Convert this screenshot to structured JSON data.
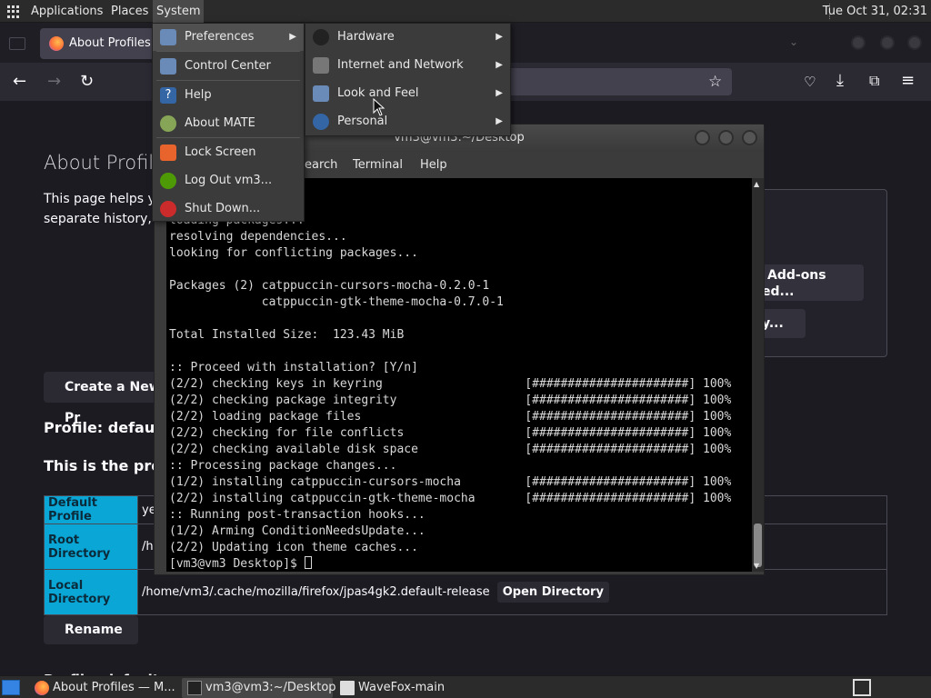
{
  "top_panel": {
    "menus": [
      "Applications",
      "Places",
      "System"
    ],
    "clock": "Tue Oct 31, 02:31"
  },
  "firefox": {
    "tab_title": "About Profiles",
    "content": {
      "title": "About Profile",
      "desc_line1": "This page helps yo",
      "desc_line2": "separate history, bo",
      "addons_btn_line1": "Add-ons",
      "addons_btn_line2": "ed...",
      "ellipsis_btn": "y...",
      "create_btn": "Create a New Pr",
      "profile_heading": "Profile: default-re",
      "profile_sub": "This is the profile",
      "table": {
        "default_profile_key": "Default Profile",
        "default_profile_val": "yes",
        "root_dir_key": "Root Directory",
        "root_dir_val": "/hom",
        "local_dir_key": "Local Directory",
        "local_dir_val": "/home/vm3/.cache/mozilla/firefox/jpas4gk2.default-release",
        "open_dir_btn": "Open Directory"
      },
      "rename_btn": "Rename",
      "cutoff_heading": "Profile: default"
    }
  },
  "terminal": {
    "title": "vm3@vm3:~/Desktop",
    "menus": [
      "earch",
      "Terminal",
      "Help"
    ],
    "lines": [
      "loading packages...",
      "resolving dependencies...",
      "looking for conflicting packages...",
      "",
      "Packages (2) catppuccin-cursors-mocha-0.2.0-1",
      "             catppuccin-gtk-theme-mocha-0.7.0-1",
      "",
      "Total Installed Size:  123.43 MiB",
      "",
      ":: Proceed with installation? [Y/n]",
      "(2/2) checking keys in keyring                    [######################] 100%",
      "(2/2) checking package integrity                  [######################] 100%",
      "(2/2) loading package files                       [######################] 100%",
      "(2/2) checking for file conflicts                 [######################] 100%",
      "(2/2) checking available disk space               [######################] 100%",
      ":: Processing package changes...",
      "(1/2) installing catppuccin-cursors-mocha         [######################] 100%",
      "(2/2) installing catppuccin-gtk-theme-mocha       [######################] 100%",
      ":: Running post-transaction hooks...",
      "(1/2) Arming ConditionNeedsUpdate...",
      "(2/2) Updating icon theme caches..."
    ],
    "prompt": "[vm3@vm3 Desktop]$ "
  },
  "system_menu": {
    "items": [
      {
        "label": "Preferences",
        "icon": "preferences-icon"
      },
      {
        "label": "Control Center",
        "icon": "control-center-icon"
      },
      {
        "label": "Help",
        "icon": "help-icon"
      },
      {
        "label": "About MATE",
        "icon": "about-mate-icon"
      },
      {
        "label": "Lock Screen",
        "icon": "lock-icon"
      },
      {
        "label": "Log Out vm3...",
        "icon": "logout-icon"
      },
      {
        "label": "Shut Down...",
        "icon": "power-icon"
      }
    ]
  },
  "preferences_submenu": {
    "items": [
      {
        "label": "Hardware",
        "icon": "hardware-icon"
      },
      {
        "label": "Internet and Network",
        "icon": "network-icon"
      },
      {
        "label": "Look and Feel",
        "icon": "look-feel-icon"
      },
      {
        "label": "Personal",
        "icon": "personal-icon"
      }
    ]
  },
  "taskbar": {
    "tasks": [
      "About Profiles — M...",
      "vm3@vm3:~/Desktop",
      "WaveFox-main"
    ]
  },
  "colors": {
    "panel_bg": "#2b2b2b",
    "table_key_bg": "#0aa6d6",
    "menu_bg": "#3b3b3b"
  }
}
